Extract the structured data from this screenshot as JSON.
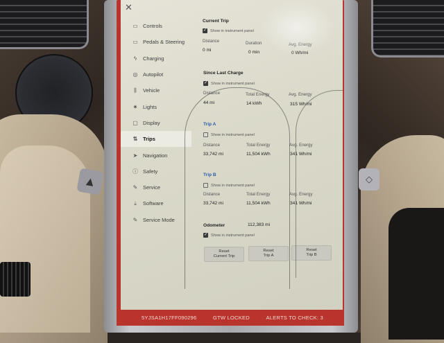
{
  "sidebar": {
    "close_icon": "close-icon",
    "items": [
      {
        "label": "Controls",
        "icon": "car-icon"
      },
      {
        "label": "Pedals & Steering",
        "icon": "car-icon"
      },
      {
        "label": "Charging",
        "icon": "bolt-icon"
      },
      {
        "label": "Autopilot",
        "icon": "steering-wheel-icon"
      },
      {
        "label": "Vehicle",
        "icon": "sliders-icon"
      },
      {
        "label": "Lights",
        "icon": "sun-icon"
      },
      {
        "label": "Display",
        "icon": "display-icon"
      },
      {
        "label": "Trips",
        "icon": "trips-icon"
      },
      {
        "label": "Navigation",
        "icon": "navigation-icon"
      },
      {
        "label": "Safety",
        "icon": "safety-icon"
      },
      {
        "label": "Service",
        "icon": "wrench-icon"
      },
      {
        "label": "Software",
        "icon": "download-icon"
      },
      {
        "label": "Service Mode",
        "icon": "wrench-icon"
      }
    ],
    "active": "Trips"
  },
  "current_trip": {
    "title": "Current Trip",
    "show_in_panel": "Show in instrument panel",
    "checked": true,
    "labels": {
      "distance": "Distance",
      "duration": "Duration",
      "avg_energy": "Avg. Energy"
    },
    "values": {
      "distance": "0 mi",
      "duration": "0 min",
      "avg_energy": "0 Wh/mi"
    }
  },
  "since_last_charge": {
    "title": "Since Last Charge",
    "show_in_panel": "Show in instrument panel",
    "checked": true,
    "labels": {
      "distance": "Distance",
      "total_energy": "Total Energy",
      "avg_energy": "Avg. Energy"
    },
    "values": {
      "distance": "44 mi",
      "total_energy": "14 kWh",
      "avg_energy": "315 Wh/mi"
    }
  },
  "trip_a": {
    "title": "Trip A",
    "show_in_panel": "Show in instrument panel",
    "checked": false,
    "labels": {
      "distance": "Distance",
      "total_energy": "Total Energy",
      "avg_energy": "Avg. Energy"
    },
    "values": {
      "distance": "33,742 mi",
      "total_energy": "11,504 kWh",
      "avg_energy": "341 Wh/mi"
    }
  },
  "trip_b": {
    "title": "Trip B",
    "show_in_panel": "Show in instrument panel",
    "checked": false,
    "labels": {
      "distance": "Distance",
      "total_energy": "Total Energy",
      "avg_energy": "Avg. Energy"
    },
    "values": {
      "distance": "33,742 mi",
      "total_energy": "11,504 kWh",
      "avg_energy": "341 Wh/mi"
    }
  },
  "odometer": {
    "label": "Odometer",
    "value": "112,383 mi",
    "show_in_panel": "Show in instrument panel",
    "checked": true
  },
  "buttons": {
    "reset_current": "Reset\nCurrent Trip",
    "reset_a": "Reset\nTrip A",
    "reset_b": "Reset\nTrip B"
  },
  "status_bar": {
    "vin": "5YJSA1H17FF090296",
    "gtw": "GTW LOCKED",
    "alerts": "ALERTS TO CHECK: 3"
  },
  "colors": {
    "status_bar_red": "#b9342c",
    "accent_blue": "#2c5ea8",
    "screen_bg": "#e6e4d8"
  }
}
